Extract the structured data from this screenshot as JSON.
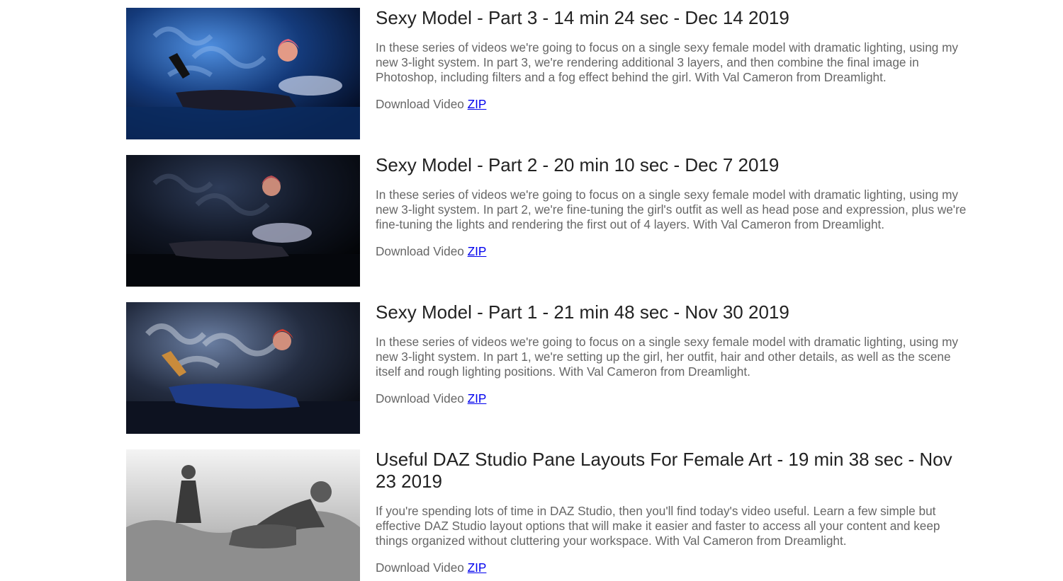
{
  "videos": [
    {
      "title": "Sexy Model - Part 3 - 14 min 24 sec - Dec 14 2019",
      "description": "In these series of videos we're going to focus on a single sexy female model with dramatic lighting, using my new 3-light system. In part 3, we're rendering additional 3 layers, and then combine the final image in Photoshop, including filters and a fog effect behind the girl. With Val Cameron from Dreamlight.",
      "download_label": "Download Video",
      "zip_link": "ZIP",
      "thumb_palette": {
        "bg": "#0a1f4a",
        "glow": "#3a78c9",
        "floor": "#0b2a5e"
      }
    },
    {
      "title": "Sexy Model - Part 2 - 20 min 10 sec - Dec 7 2019",
      "description": "In these series of videos we're going to focus on a single sexy female model with dramatic lighting, using my new 3-light system. In part 2, we're fine-tuning the girl's outfit as well as head pose and expression, plus we're fine-tuning the lights and rendering the first out of 4 layers. With Val Cameron from Dreamlight.",
      "download_label": "Download Video",
      "zip_link": "ZIP",
      "thumb_palette": {
        "bg": "#05070d",
        "glow": "#2a3a5a",
        "floor": "#06080e"
      }
    },
    {
      "title": "Sexy Model - Part 1 - 21 min 48 sec - Nov 30 2019",
      "description": "In these series of videos we're going to focus on a single sexy female model with dramatic lighting, using my new 3-light system. In part 1, we're setting up the girl, her outfit, hair and other details, as well as the scene itself and rough lighting positions. With Val Cameron from Dreamlight.",
      "download_label": "Download Video",
      "zip_link": "ZIP",
      "thumb_palette": {
        "bg": "#101522",
        "glow": "#5a6f93",
        "floor": "#0d1220"
      }
    },
    {
      "title": "Useful DAZ Studio Pane Layouts For Female Art - 19 min 38 sec - Nov 23 2019",
      "description": "If you're spending lots of time in DAZ Studio, then you'll find today's video useful. Learn a few simple but effective DAZ Studio layout options that will make it easier and faster to access all your content and keep things organized without cluttering your workspace. With Val Cameron from Dreamlight.",
      "download_label": "Download Video",
      "zip_link": "ZIP",
      "thumb_palette": {
        "bg": "#9a9a9a",
        "glow": "#f2f2f2",
        "floor": "#6e6e6e"
      }
    }
  ]
}
